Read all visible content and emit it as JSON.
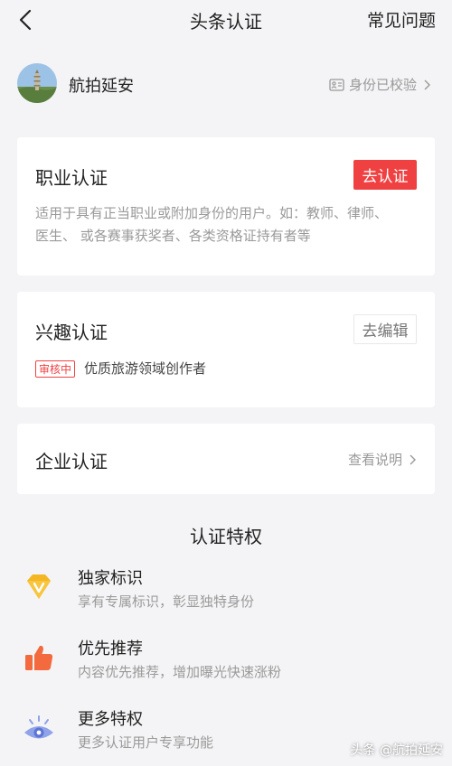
{
  "header": {
    "title": "头条认证",
    "faq_label": "常见问题"
  },
  "profile": {
    "name": "航拍延安",
    "status": "身份已校验"
  },
  "cards": {
    "occupation": {
      "title": "职业认证",
      "button": "去认证",
      "desc_line1": "适用于具有正当职业或附加身份的用户。如：教师、律师、",
      "desc_line2": "医生、 或各赛事获奖者、各类资格证持有者等"
    },
    "interest": {
      "title": "兴趣认证",
      "button": "去编辑",
      "status_tag": "审核中",
      "label": "优质旅游领域创作者"
    },
    "enterprise": {
      "title": "企业认证",
      "link": "查看说明"
    }
  },
  "privileges": {
    "title": "认证特权",
    "items": [
      {
        "title": "独家标识",
        "desc": "享有专属标识，彰显独特身份",
        "icon": "diamond-v-icon"
      },
      {
        "title": "优先推荐",
        "desc": "内容优先推荐，增加曝光快速涨粉",
        "icon": "thumbs-up-icon"
      },
      {
        "title": "更多特权",
        "desc": "更多认证用户专享功能",
        "icon": "eye-icon"
      }
    ]
  },
  "watermark": "头条 @航拍延安",
  "colors": {
    "accent": "#f04142",
    "background": "#f4f4f6",
    "gold": "#f5b623",
    "orange": "#f26a3d",
    "eye_blue": "#8fa3e8"
  }
}
